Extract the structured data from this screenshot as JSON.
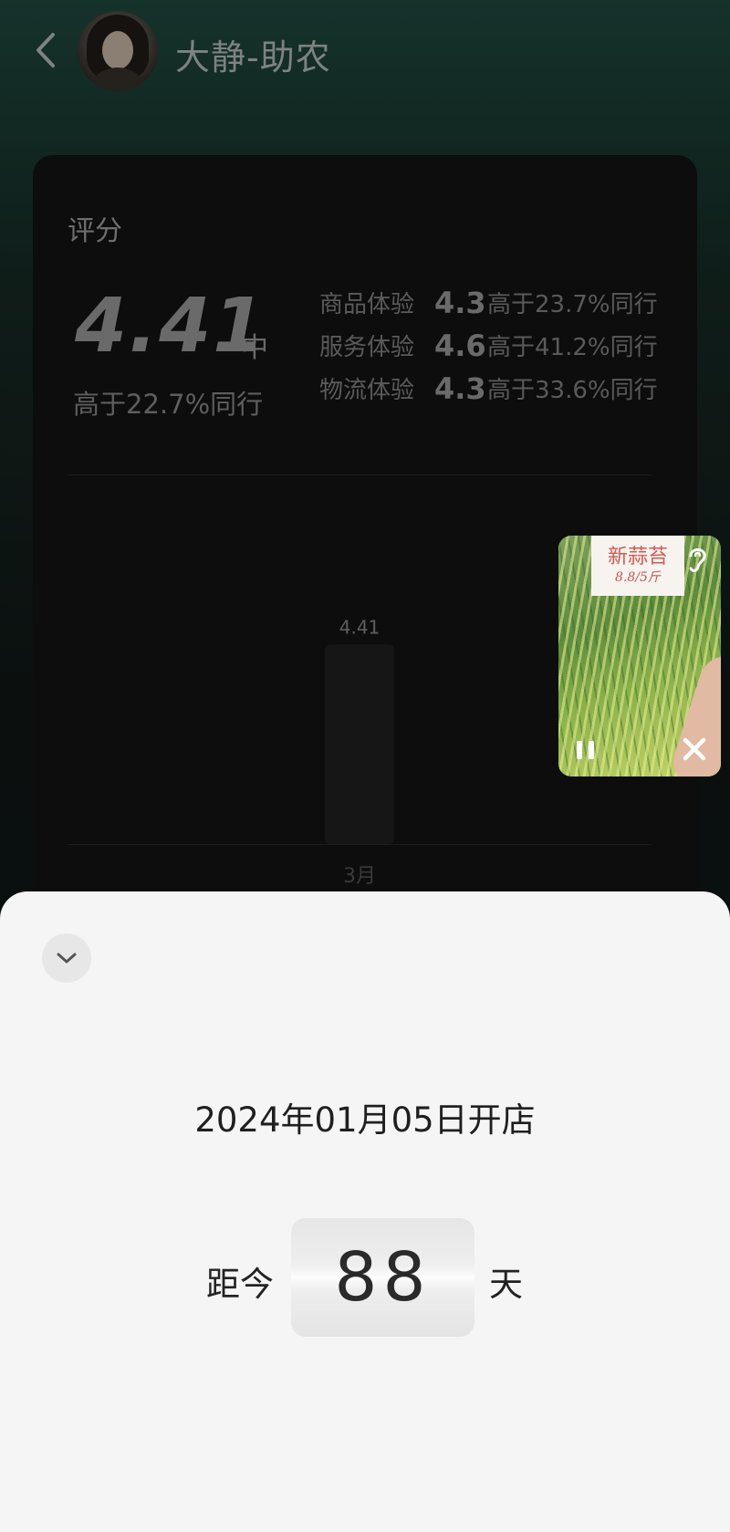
{
  "header": {
    "back_icon": "chevron-left-icon",
    "shop_name": "大静-助农"
  },
  "rating_card": {
    "title": "评分",
    "score": "4.41",
    "level": "中",
    "percentile_text": "高于22.7%同行",
    "metrics": [
      {
        "label": "商品体验",
        "value": "4.3",
        "compare": "高于23.7%同行"
      },
      {
        "label": "服务体验",
        "value": "4.6",
        "compare": "高于41.2%同行"
      },
      {
        "label": "物流体验",
        "value": "4.3",
        "compare": "高于33.6%同行"
      }
    ]
  },
  "chart_data": {
    "type": "bar",
    "categories": [
      "3月"
    ],
    "values": [
      4.41
    ],
    "data_labels": [
      "4.41"
    ],
    "ylim": [
      0,
      5
    ],
    "grid": false
  },
  "pip_video": {
    "sign_line1": "新蒜苔",
    "sign_line2": "8.8/5斤",
    "icons": [
      "ear-icon",
      "pause-icon",
      "close-icon"
    ]
  },
  "sheet": {
    "collapse_icon": "chevron-down-icon",
    "open_date": "2024年01月05日开店",
    "since_label": "距今",
    "days": "88",
    "days_unit": "天"
  },
  "colors": {
    "background_top": "#15322b",
    "card_bg": "#0d0d0d",
    "sheet_bg": "#f5f5f5",
    "pip_green": "#6f9a45",
    "sign_red": "#d8574f"
  }
}
